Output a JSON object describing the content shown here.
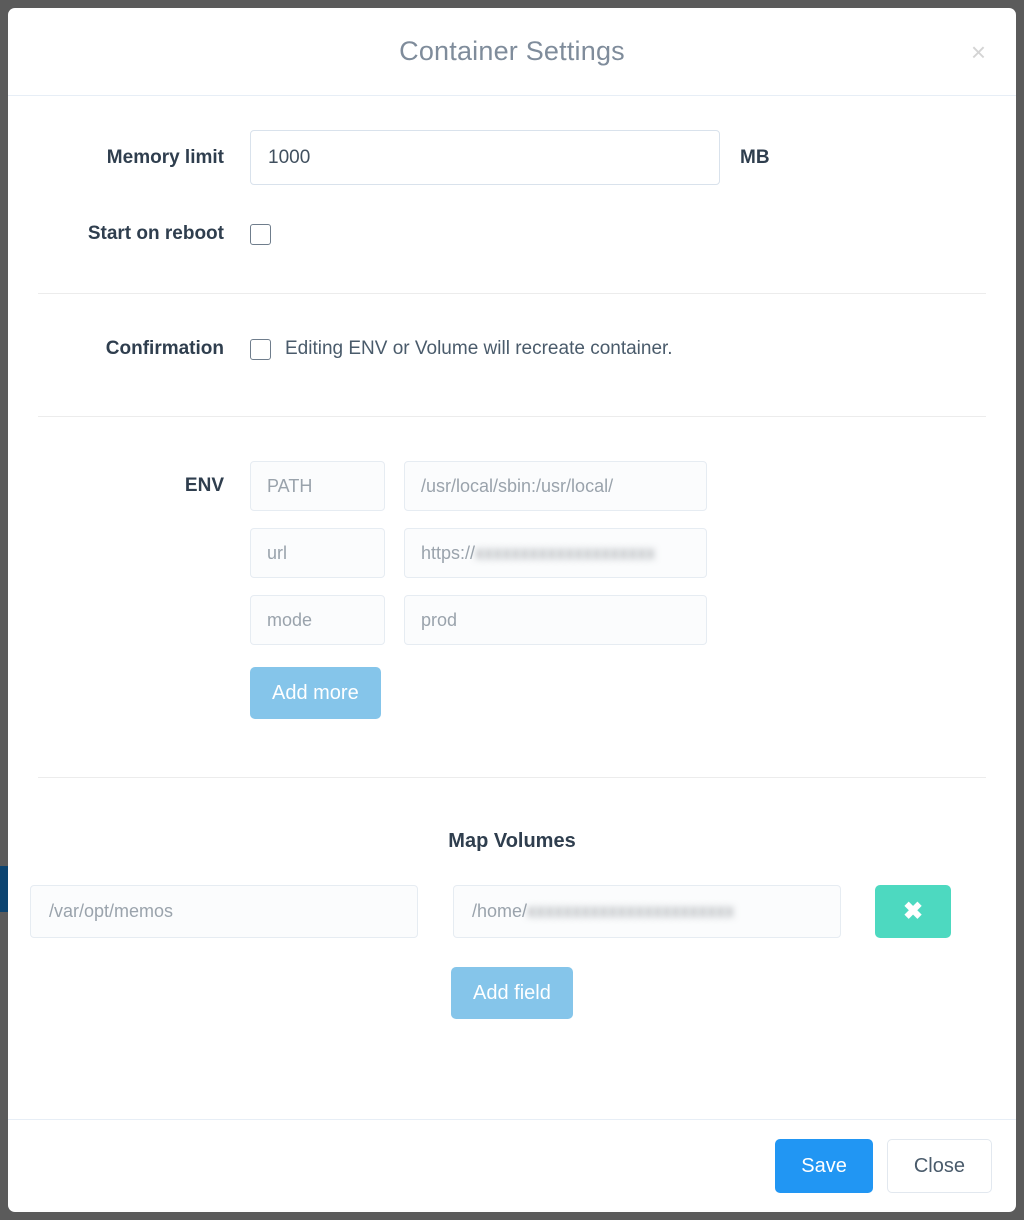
{
  "modal": {
    "title": "Container Settings",
    "close_icon": "close-x-icon",
    "close_glyph": "×"
  },
  "memory": {
    "label": "Memory limit",
    "value": "1000",
    "unit": "MB"
  },
  "start_on_reboot": {
    "label": "Start on reboot",
    "checked": false
  },
  "confirmation": {
    "label": "Confirmation",
    "text": "Editing ENV or Volume will recreate container.",
    "checked": false
  },
  "env": {
    "label": "ENV",
    "rows": [
      {
        "key": "PATH",
        "value": "/usr/local/sbin:/usr/local/",
        "redacted": false
      },
      {
        "key": "url",
        "value_prefix": "https://",
        "value_redacted": "xxxxxxxxxxxxxxxxxxxx",
        "redacted": true
      },
      {
        "key": "mode",
        "value": "prod",
        "redacted": false
      }
    ],
    "add_more_label": "Add more"
  },
  "map_volumes": {
    "title": "Map Volumes",
    "rows": [
      {
        "source": "/var/opt/memos",
        "dest_prefix": "/home/",
        "dest_redacted": "xxxxxxxxxxxxxxxxxxxxxxx",
        "delete_glyph": "✖"
      }
    ],
    "add_field_label": "Add field"
  },
  "footer": {
    "save_label": "Save",
    "close_label": "Close"
  },
  "colors": {
    "backdrop": "#5b5b5b",
    "primary": "#2196f3",
    "light_blue": "#85c5ea",
    "teal": "#4dd9c0",
    "title_gray": "#7f8c9b",
    "label_dark": "#2f3e4e"
  }
}
